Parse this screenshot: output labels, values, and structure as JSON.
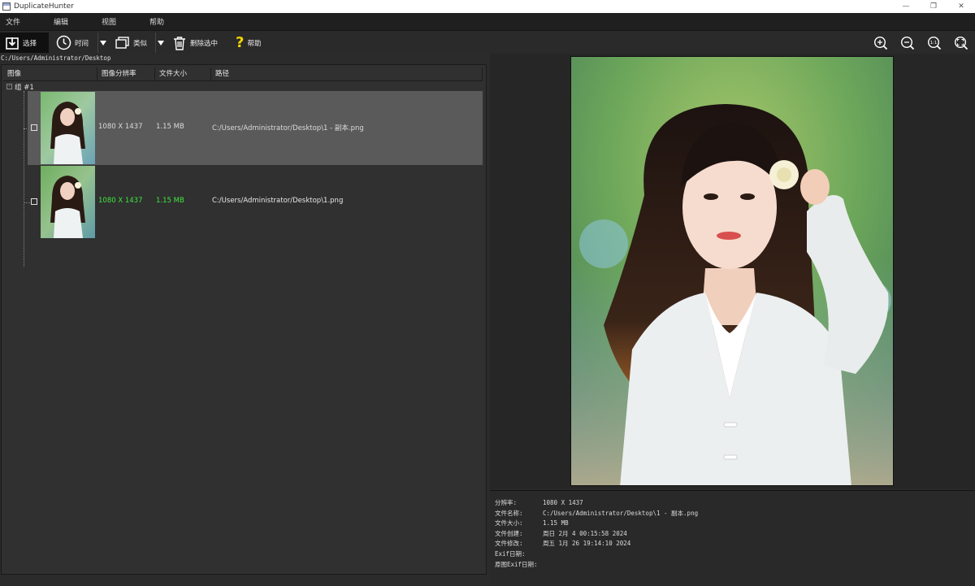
{
  "window": {
    "title": "DuplicateHunter",
    "controls": {
      "minimize": "—",
      "restore": "❐",
      "close": "✕"
    }
  },
  "menu": [
    "文件",
    "编辑",
    "视图",
    "帮助"
  ],
  "toolbar": {
    "select_label": "选择",
    "time_label": "时间",
    "similar_label": "类似",
    "delete_label": "删除选中",
    "help_label": "帮助",
    "help_glyph": "?",
    "actual_size_glyph": "1:1",
    "icons": [
      "select-icon",
      "clock-icon",
      "similar-icon",
      "trash-icon",
      "help-icon",
      "zoom-in-icon",
      "zoom-out-icon",
      "actual-size-icon",
      "fit-window-icon"
    ]
  },
  "current_path": "C:/Users/Administrator/Desktop",
  "table": {
    "columns": [
      "图像",
      "图像分辨率",
      "文件大小",
      "路径"
    ],
    "group_expander": "-",
    "group_label": "组 #1",
    "rows": [
      {
        "resolution": "1080 X 1437",
        "size": "1.15 MB",
        "path": "C:/Users/Administrator/Desktop\\1 - 副本.png",
        "selected": true,
        "checked": false,
        "highlight": false
      },
      {
        "resolution": "1080 X 1437",
        "size": "1.15 MB",
        "path": "C:/Users/Administrator/Desktop\\1.png",
        "selected": false,
        "checked": false,
        "highlight": true
      }
    ]
  },
  "info": [
    {
      "key": "分辨率:",
      "value": "1080 X 1437"
    },
    {
      "key": "文件名称:",
      "value": "C:/Users/Administrator/Desktop\\1 - 副本.png"
    },
    {
      "key": "文件大小:",
      "value": "1.15 MB"
    },
    {
      "key": "文件创建:",
      "value": "周日 2月 4 00:15:58 2024"
    },
    {
      "key": "文件修改:",
      "value": "周五 1月 26 19:14:10 2024"
    },
    {
      "key": "Exif日期:",
      "value": ""
    },
    {
      "key": "原图Exif日期:",
      "value": ""
    }
  ],
  "colors": {
    "highlight_text": "#3ee63e",
    "selected_row": "#5a5a5a",
    "background": "#2b2b2b"
  }
}
